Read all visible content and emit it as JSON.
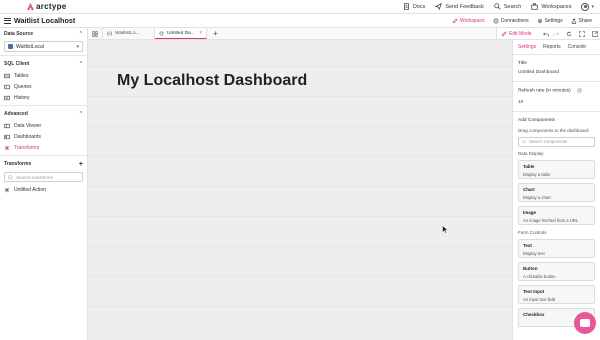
{
  "topbar": {
    "brand": "arctype",
    "actions": [
      {
        "label": "Docs",
        "icon": "doc-icon"
      },
      {
        "label": "Send Feedback",
        "icon": "send-icon"
      },
      {
        "label": "Search",
        "icon": "search-icon"
      },
      {
        "label": "Workspaces",
        "icon": "workspaces-icon"
      }
    ]
  },
  "appbar": {
    "title": "Waitlist Localhost",
    "workspace": "Workspace",
    "connections": "Connections",
    "settings": "Settings",
    "share": "Share"
  },
  "sidebar": {
    "data_source": {
      "heading": "Data Source",
      "selected": "WaitlistLocal"
    },
    "sql_client": {
      "heading": "SQL Client",
      "items": [
        "Tables",
        "Queries",
        "History"
      ]
    },
    "advanced": {
      "heading": "Advanced",
      "items": [
        "Data Viewer",
        "Dashboards",
        "Transforms"
      ]
    },
    "transforms": {
      "heading": "Transforms",
      "search_placeholder": "Search transforms",
      "items": [
        "Untitled Action"
      ]
    }
  },
  "tabs": [
    {
      "label": "WaitlistLo..."
    },
    {
      "label": "Untitled Da..."
    }
  ],
  "editor": {
    "edit_mode": "Edit Mode"
  },
  "canvas": {
    "title": "My Localhost Dashboard"
  },
  "panel": {
    "tabs": [
      "Settings",
      "Reports",
      "Console"
    ],
    "title_label": "Title",
    "title_value": "Untitled Dashboard",
    "refresh_label": "Refresh rate (in minutes)",
    "refresh_value": "10",
    "components_heading": "Add Components",
    "components_hint": "Drag components to the dashboard",
    "search_placeholder": "Search components",
    "data_display_heading": "Data Display",
    "data_display": [
      {
        "title": "Table",
        "desc": "Display a table"
      },
      {
        "title": "Chart",
        "desc": "Display a chart"
      },
      {
        "title": "Image",
        "desc": "An image fetched from a URL"
      }
    ],
    "form_controls_heading": "Form Controls",
    "form_controls": [
      {
        "title": "Text",
        "desc": "Display text"
      },
      {
        "title": "Button",
        "desc": "A clickable button"
      },
      {
        "title": "Text Input",
        "desc": "An input text field"
      },
      {
        "title": "Checkbox",
        "desc": ""
      }
    ]
  },
  "colors": {
    "accent": "#d63384",
    "canvas": "#eeeeee",
    "chat_button": "#e8579a"
  }
}
